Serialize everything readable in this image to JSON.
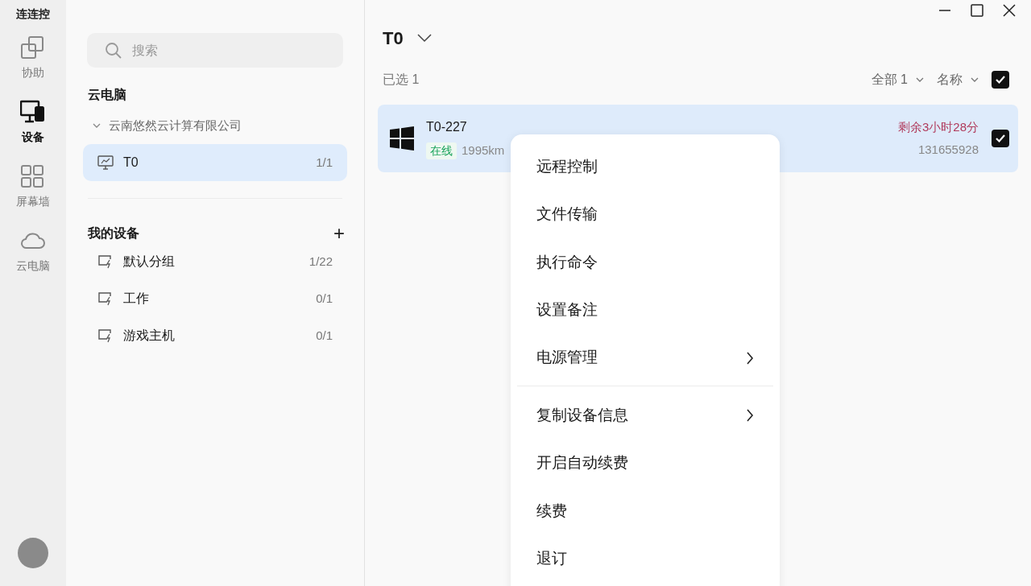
{
  "app_title": "连连控",
  "nav": [
    {
      "label": "协助",
      "selected": false
    },
    {
      "label": "设备",
      "selected": true
    },
    {
      "label": "屏幕墙",
      "selected": false
    },
    {
      "label": "云电脑",
      "selected": false
    }
  ],
  "search": {
    "placeholder": "搜索"
  },
  "cloud_section": {
    "title": "云电脑",
    "company": {
      "label": "云南悠然云计算有限公司",
      "expanded": true,
      "groups": [
        {
          "label": "T0",
          "count": "1/1",
          "selected": true
        }
      ]
    }
  },
  "my_devices": {
    "title": "我的设备",
    "add": "+",
    "groups": [
      {
        "label": "默认分组",
        "count": "1/22"
      },
      {
        "label": "工作",
        "count": "0/1"
      },
      {
        "label": "游戏主机",
        "count": "0/1"
      }
    ]
  },
  "main": {
    "title": "T0",
    "selected_count": "已选 1",
    "filter": "全部 1",
    "sort": "名称",
    "select_all": true,
    "devices": [
      {
        "name": "T0-227",
        "status": "在线",
        "distance": "1995km",
        "remaining": "剩余3小时28分",
        "id": "131655928",
        "checked": true
      }
    ]
  },
  "context_menu": [
    {
      "label": "远程控制",
      "submenu": false,
      "divider_after": false
    },
    {
      "label": "文件传输",
      "submenu": false,
      "divider_after": false
    },
    {
      "label": "执行命令",
      "submenu": false,
      "divider_after": false
    },
    {
      "label": "设置备注",
      "submenu": false,
      "divider_after": false
    },
    {
      "label": "电源管理",
      "submenu": true,
      "divider_after": true
    },
    {
      "label": "复制设备信息",
      "submenu": true,
      "divider_after": false
    },
    {
      "label": "开启自动续费",
      "submenu": false,
      "divider_after": false
    },
    {
      "label": "续费",
      "submenu": false,
      "divider_after": false
    },
    {
      "label": "退订",
      "submenu": false,
      "divider_after": false
    }
  ]
}
